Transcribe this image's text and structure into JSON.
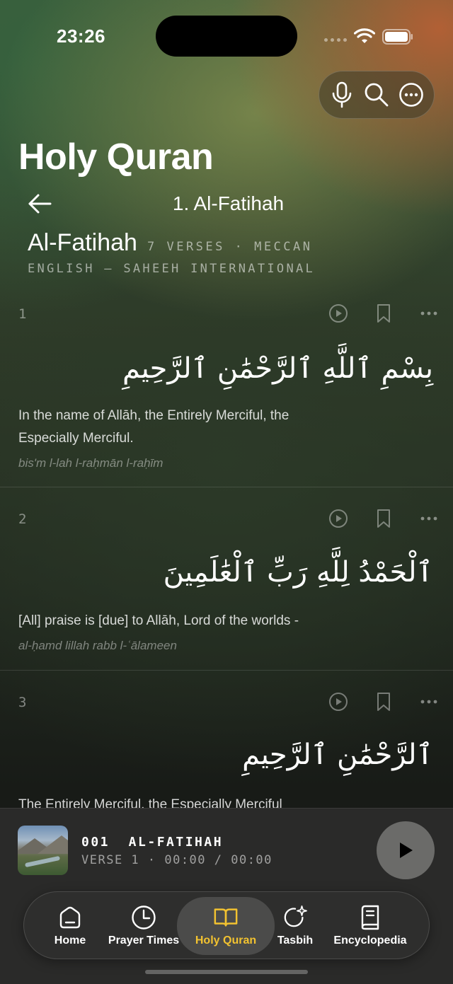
{
  "status_bar": {
    "time": "23:26"
  },
  "header": {
    "title": "Holy Quran",
    "nav_title": "1. Al-Fatihah",
    "toolbar_icons": [
      "microphone-icon",
      "search-icon",
      "more-icon"
    ]
  },
  "surah": {
    "name": "Al-Fatihah",
    "meta": "7 VERSES · MECCAN",
    "translation_label": "ENGLISH — SAHEEH INTERNATIONAL"
  },
  "verses": [
    {
      "number": "1",
      "arabic": "بِسْمِ ٱللَّهِ ٱلرَّحْمَٰنِ ٱلرَّحِيمِ",
      "translation_line1": "In the name of Allāh, the Entirely Merciful, the",
      "translation_line2": "Especially Merciful.",
      "transliteration": "bis'm l-lah l-raḥmān l-raḥīm"
    },
    {
      "number": "2",
      "arabic": "ٱلْحَمْدُ لِلَّهِ رَبِّ ٱلْعَٰلَمِينَ",
      "translation_line1": "[All] praise is [due] to Allāh, Lord of the worlds -",
      "transliteration": "al-ḥamd lillah rabb l-ʿālameen"
    },
    {
      "number": "3",
      "arabic": "ٱلرَّحْمَٰنِ ٱلرَّحِيمِ",
      "translation_line1": "The Entirely Merciful, the Especially Merciful"
    }
  ],
  "verse_actions": [
    "play-icon",
    "bookmark-icon",
    "more-icon"
  ],
  "player": {
    "title": "001  AL-FATIHAH",
    "subtitle": "VERSE 1 · 00:00 / 00:00"
  },
  "tabs": [
    {
      "label": "Home",
      "icon": "home-icon",
      "active": false
    },
    {
      "label": "Prayer Times",
      "icon": "clock-icon",
      "active": false
    },
    {
      "label": "Holy Quran",
      "icon": "book-icon",
      "active": true
    },
    {
      "label": "Tasbih",
      "icon": "sparkle-icon",
      "active": false
    },
    {
      "label": "Encyclopedia",
      "icon": "encyclopedia-icon",
      "active": false
    }
  ],
  "colors": {
    "active_tab": "#f2c230",
    "tajweed_green": "#3fbf4a",
    "tajweed_orange": "#e06a2c",
    "tajweed_purple": "#a23bd6",
    "tajweed_blue": "#3a8fe0"
  }
}
